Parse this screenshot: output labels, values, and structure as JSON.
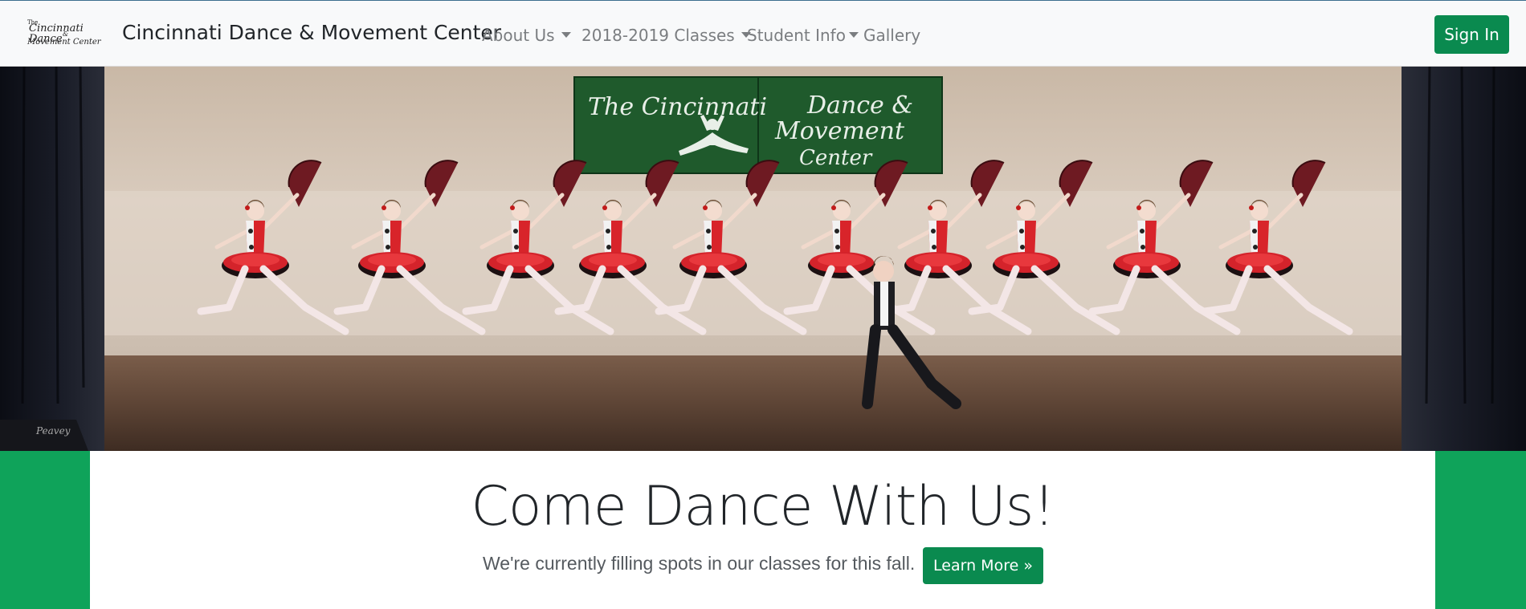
{
  "navbar": {
    "logo": {
      "line1": "The",
      "line2": "Cincinnati Dance",
      "line3": "&",
      "line4": "Movement Center"
    },
    "brand": "Cincinnati Dance & Movement Center",
    "items": [
      {
        "label": "About Us",
        "dropdown": true
      },
      {
        "label": "2018-2019 Classes",
        "dropdown": true
      },
      {
        "label": "Student Info",
        "dropdown": true
      },
      {
        "label": "Gallery",
        "dropdown": false
      }
    ],
    "sign_in_label": "Sign In"
  },
  "hero": {
    "banner": {
      "line1": "The Cincinnati",
      "line2": "Dance &",
      "line3": "Movement",
      "line4": "Center"
    },
    "speaker_brand": "Peavey"
  },
  "jumbotron": {
    "headline": "Come Dance With Us!",
    "lead": "We're currently filling spots in our classes for this fall.",
    "cta_label": "Learn More »"
  },
  "colors": {
    "brand_green": "#0a8a4f",
    "side_green": "#0fa35a",
    "navbar_bg": "#f8f9fa"
  }
}
